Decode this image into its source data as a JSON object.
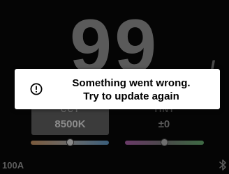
{
  "display": {
    "big_readout": "99",
    "big_readout_suffix": "/"
  },
  "cct": {
    "label": "CCT",
    "value": "8500K",
    "slider_position": 0.5
  },
  "tint": {
    "label": "TINT",
    "value": "±0",
    "slider_position": 0.5
  },
  "status": {
    "battery": "100A",
    "bluetooth_icon": "bluetooth-icon"
  },
  "toast": {
    "icon": "alert-circle-icon",
    "line1": "Something went wrong.",
    "line2": "Try to update again"
  },
  "colors": {
    "background": "#050505",
    "toast_bg": "#ffffff",
    "toast_text": "#000000"
  }
}
